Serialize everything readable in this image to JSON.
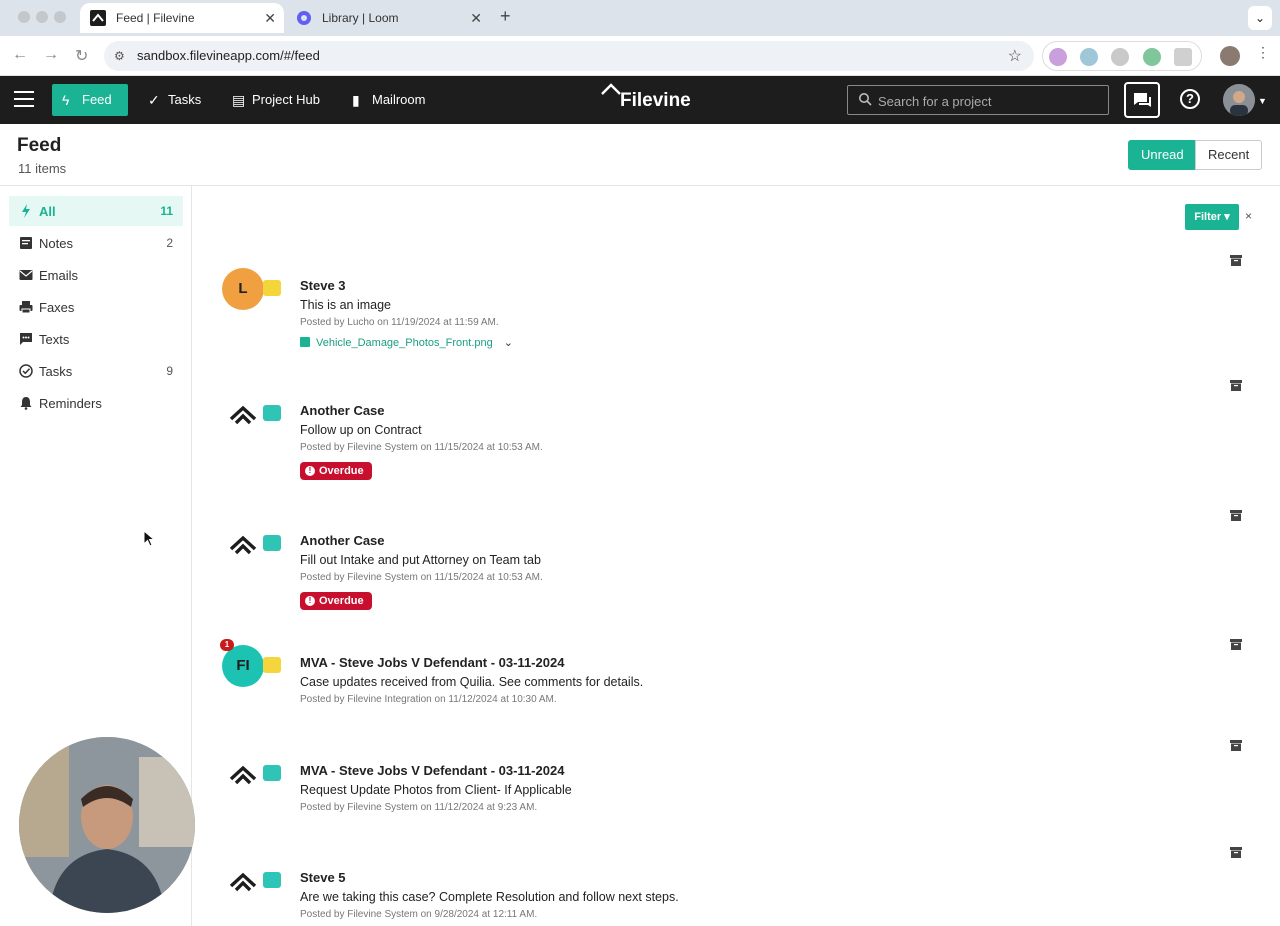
{
  "browser": {
    "tabs": [
      {
        "title": "Feed | Filevine",
        "active": true
      },
      {
        "title": "Library | Loom",
        "active": false
      }
    ],
    "url": "sandbox.filevineapp.com/#/feed"
  },
  "header": {
    "nav": [
      {
        "label": "Feed",
        "icon": "bolt-icon",
        "active": true
      },
      {
        "label": "Tasks",
        "icon": "check-circle-icon"
      },
      {
        "label": "Project Hub",
        "icon": "dashboard-icon"
      },
      {
        "label": "Mailroom",
        "icon": "mailbox-icon"
      }
    ],
    "brand": "Filevine",
    "search_placeholder": "Search for a project",
    "help_label": "?"
  },
  "page": {
    "title": "Feed",
    "count": "11 items",
    "toggle": {
      "unread": "Unread",
      "recent": "Recent"
    }
  },
  "sidebar": {
    "items": [
      {
        "label": "All",
        "count": "11",
        "icon": "bolt-icon",
        "active": true
      },
      {
        "label": "Notes",
        "count": "2",
        "icon": "note-icon"
      },
      {
        "label": "Emails",
        "count": "",
        "icon": "envelope-icon"
      },
      {
        "label": "Faxes",
        "count": "",
        "icon": "printer-icon"
      },
      {
        "label": "Texts",
        "count": "",
        "icon": "text-message-icon"
      },
      {
        "label": "Tasks",
        "count": "9",
        "icon": "check-circle-icon"
      },
      {
        "label": "Reminders",
        "count": "",
        "icon": "bell-icon"
      }
    ]
  },
  "filter": {
    "label": "Filter ▾",
    "clear": "×"
  },
  "feed": [
    {
      "avatar": "L",
      "avatar_color": "#f0a040",
      "type": "note",
      "title": "Steve 3",
      "body": "This is an image",
      "meta": "Posted by Lucho on 11/19/2024 at 11:59 AM.",
      "attachment": "Vehicle_Damage_Photos_Front.png"
    },
    {
      "avatar": "",
      "avatar_color": "logo",
      "type": "task",
      "title": "Another Case",
      "body": "Follow up on Contract",
      "meta": "Posted by Filevine System on 11/15/2024 at 10:53 AM.",
      "status": "Overdue"
    },
    {
      "avatar": "",
      "avatar_color": "logo",
      "type": "task",
      "title": "Another Case",
      "body": "Fill out Intake and put Attorney on Team tab",
      "meta": "Posted by Filevine System on 11/15/2024 at 10:53 AM.",
      "status": "Overdue"
    },
    {
      "avatar": "FI",
      "avatar_color": "#1cc3b2",
      "type": "note",
      "badge": "1",
      "title": "MVA - Steve Jobs V Defendant - 03-11-2024",
      "body": "Case updates received from Quilia. See comments for details.",
      "meta": "Posted by Filevine Integration on 11/12/2024 at 10:30 AM."
    },
    {
      "avatar": "",
      "avatar_color": "logo",
      "type": "task",
      "title": "MVA - Steve Jobs V Defendant - 03-11-2024",
      "body": "Request Update Photos from Client- If Applicable",
      "meta": "Posted by Filevine System on 11/12/2024 at 9:23 AM."
    },
    {
      "avatar": "",
      "avatar_color": "logo",
      "type": "task",
      "title": "Steve 5",
      "body": "Are we taking this case? Complete Resolution and follow next steps.",
      "meta": "Posted by Filevine System on 9/28/2024 at 12:11 AM."
    }
  ]
}
